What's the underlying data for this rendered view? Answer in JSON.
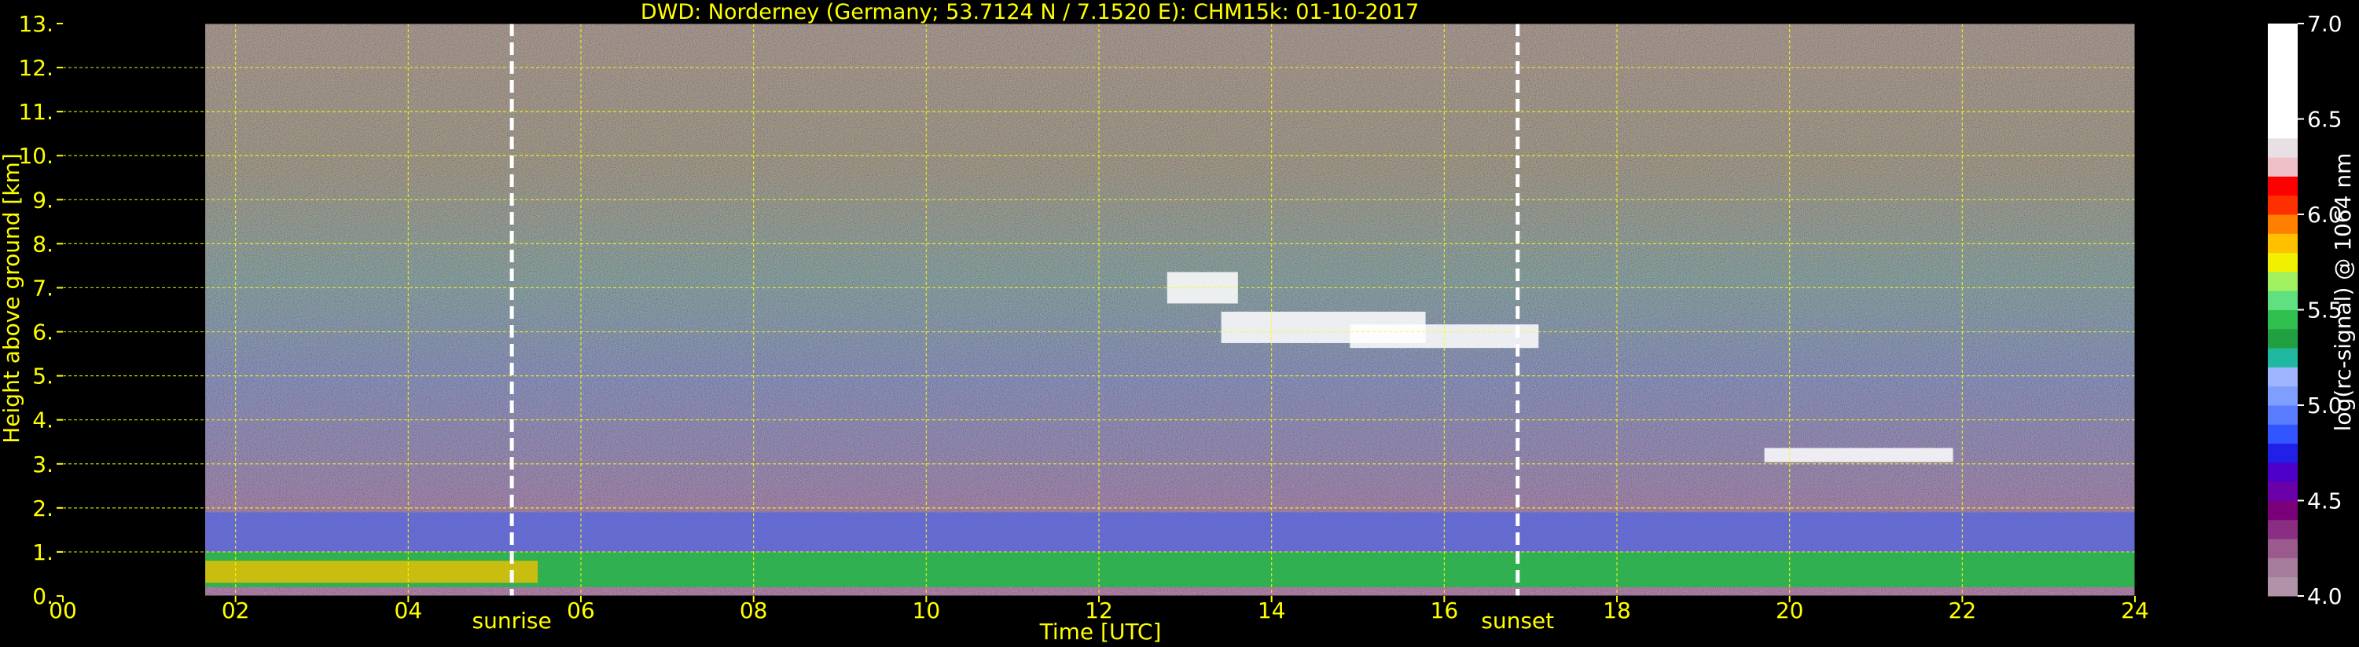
{
  "colors": {
    "background": "#000000",
    "text": "#ffff00",
    "grid": "#ffff00",
    "marker": "#ffffff",
    "colorbar_text": "#ffffff"
  },
  "chart_data": {
    "type": "heatmap",
    "title": "DWD: Norderney (Germany; 53.7124 N / 7.1520 E):    CHM15k: 01-10-2017",
    "xlabel": "Time [UTC]",
    "ylabel": "Height above ground [km]",
    "xlim": [
      0,
      24
    ],
    "ylim": [
      0,
      13
    ],
    "x_tick_labels": [
      "00",
      "02",
      "04",
      "06",
      "08",
      "10",
      "12",
      "14",
      "16",
      "18",
      "20",
      "22",
      "24"
    ],
    "y_tick_labels": [
      "0.",
      "1.",
      "2.",
      "3.",
      "4.",
      "5.",
      "6.",
      "7.",
      "8.",
      "9.",
      "10.",
      "11.",
      "12.",
      "13."
    ],
    "grid": true,
    "data_start_hour": 1.65,
    "markers": [
      {
        "label": "sunrise",
        "hour": 5.2
      },
      {
        "label": "sunset",
        "hour": 16.85
      }
    ],
    "colorbar": {
      "label": "log(rc-signal) @ 1064 nm",
      "range": [
        4.0,
        7.0
      ],
      "tick_labels": [
        "4.0",
        "4.5",
        "5.0",
        "5.5",
        "6.0",
        "6.5",
        "7.0"
      ],
      "bands": [
        {
          "from": 4.0,
          "to": 4.1,
          "color": "#b093a8"
        },
        {
          "from": 4.1,
          "to": 4.2,
          "color": "#a67c9c"
        },
        {
          "from": 4.2,
          "to": 4.3,
          "color": "#9b5a8e"
        },
        {
          "from": 4.3,
          "to": 4.4,
          "color": "#8a2e83"
        },
        {
          "from": 4.4,
          "to": 4.5,
          "color": "#7a007a"
        },
        {
          "from": 4.5,
          "to": 4.6,
          "color": "#6a00a8"
        },
        {
          "from": 4.6,
          "to": 4.7,
          "color": "#4d00c8"
        },
        {
          "from": 4.7,
          "to": 4.8,
          "color": "#2020e8"
        },
        {
          "from": 4.8,
          "to": 4.9,
          "color": "#3355ff"
        },
        {
          "from": 4.9,
          "to": 5.0,
          "color": "#5a7dff"
        },
        {
          "from": 5.0,
          "to": 5.1,
          "color": "#7f9fff"
        },
        {
          "from": 5.1,
          "to": 5.2,
          "color": "#9fb5ff"
        },
        {
          "from": 5.2,
          "to": 5.3,
          "color": "#20b8a0"
        },
        {
          "from": 5.3,
          "to": 5.4,
          "color": "#20a040"
        },
        {
          "from": 5.4,
          "to": 5.5,
          "color": "#30c050"
        },
        {
          "from": 5.5,
          "to": 5.6,
          "color": "#60e080"
        },
        {
          "from": 5.6,
          "to": 5.7,
          "color": "#a0f060"
        },
        {
          "from": 5.7,
          "to": 5.8,
          "color": "#f0f000"
        },
        {
          "from": 5.8,
          "to": 5.9,
          "color": "#ffc000"
        },
        {
          "from": 5.9,
          "to": 6.0,
          "color": "#ff8000"
        },
        {
          "from": 6.0,
          "to": 6.1,
          "color": "#ff3000"
        },
        {
          "from": 6.1,
          "to": 6.2,
          "color": "#ff0000"
        },
        {
          "from": 6.2,
          "to": 6.3,
          "color": "#f0c0c8"
        },
        {
          "from": 6.3,
          "to": 6.4,
          "color": "#e8e0e4"
        },
        {
          "from": 6.4,
          "to": 7.0,
          "color": "#ffffff"
        }
      ]
    }
  }
}
